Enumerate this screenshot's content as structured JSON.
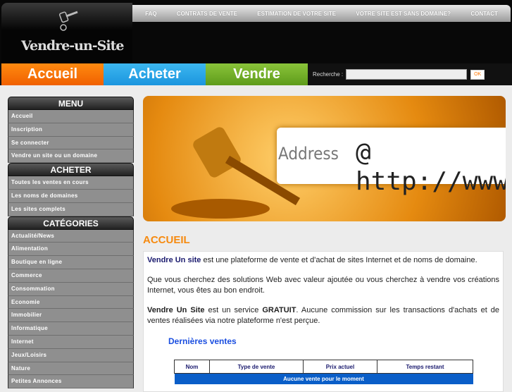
{
  "logo": {
    "name": "Vendre-un-Site"
  },
  "topnav": [
    "FAQ",
    "CONTRATS DE VENTE",
    "ESTIMATION DE VOTRE SITE",
    "VOTRE SITE EST SANS DOMAINE?",
    "CONTACT"
  ],
  "tabs": [
    "Accueil",
    "Acheter",
    "Vendre"
  ],
  "search": {
    "label": "Recherche :",
    "value": "",
    "button": "OK"
  },
  "sidebar": {
    "menu": {
      "title": "MENU",
      "items": [
        "Accueil",
        "Inscription",
        "Se connecter",
        "Vendre un site ou un domaine"
      ]
    },
    "acheter": {
      "title": "ACHETER",
      "items": [
        "Toutes les ventes en cours",
        "Les noms de domaines",
        "Les sites complets"
      ]
    },
    "categories": {
      "title": "CATÉGORIES",
      "items": [
        "Actualité/News",
        "Alimentation",
        "Boutique en ligne",
        "Commerce",
        "Consommation",
        "Economie",
        "Immobilier",
        "Informatique",
        "Internet",
        "Jeux/Loisirs",
        "Nature",
        "Petites Annonces"
      ]
    }
  },
  "banner": {
    "address": "Address",
    "url": "@ http://www"
  },
  "main": {
    "title": "ACCUEIL",
    "p1_strong": "Vendre Un site",
    "p1": " est une plateforme de vente et d'achat de sites Internet et de noms de domaine.",
    "p2": "Que vous cherchez des solutions Web avec valeur ajoutée ou vous cherchez à vendre vos créations Internet, vous êtes au bon endroit.",
    "p3_strong": "Vendre Un Site",
    "p3_a": " est un service ",
    "p3_gratuit": "GRATUIT",
    "p3_b": ". Aucune commission sur les transactions d'achats et de ventes réalisées via notre plateforme n'est perçue.",
    "sales_title": "Dernières ventes",
    "table": {
      "headers": [
        "Nom",
        "Type de vente",
        "Prix actuel",
        "Temps restant"
      ],
      "empty": "Aucune vente pour le moment"
    }
  }
}
